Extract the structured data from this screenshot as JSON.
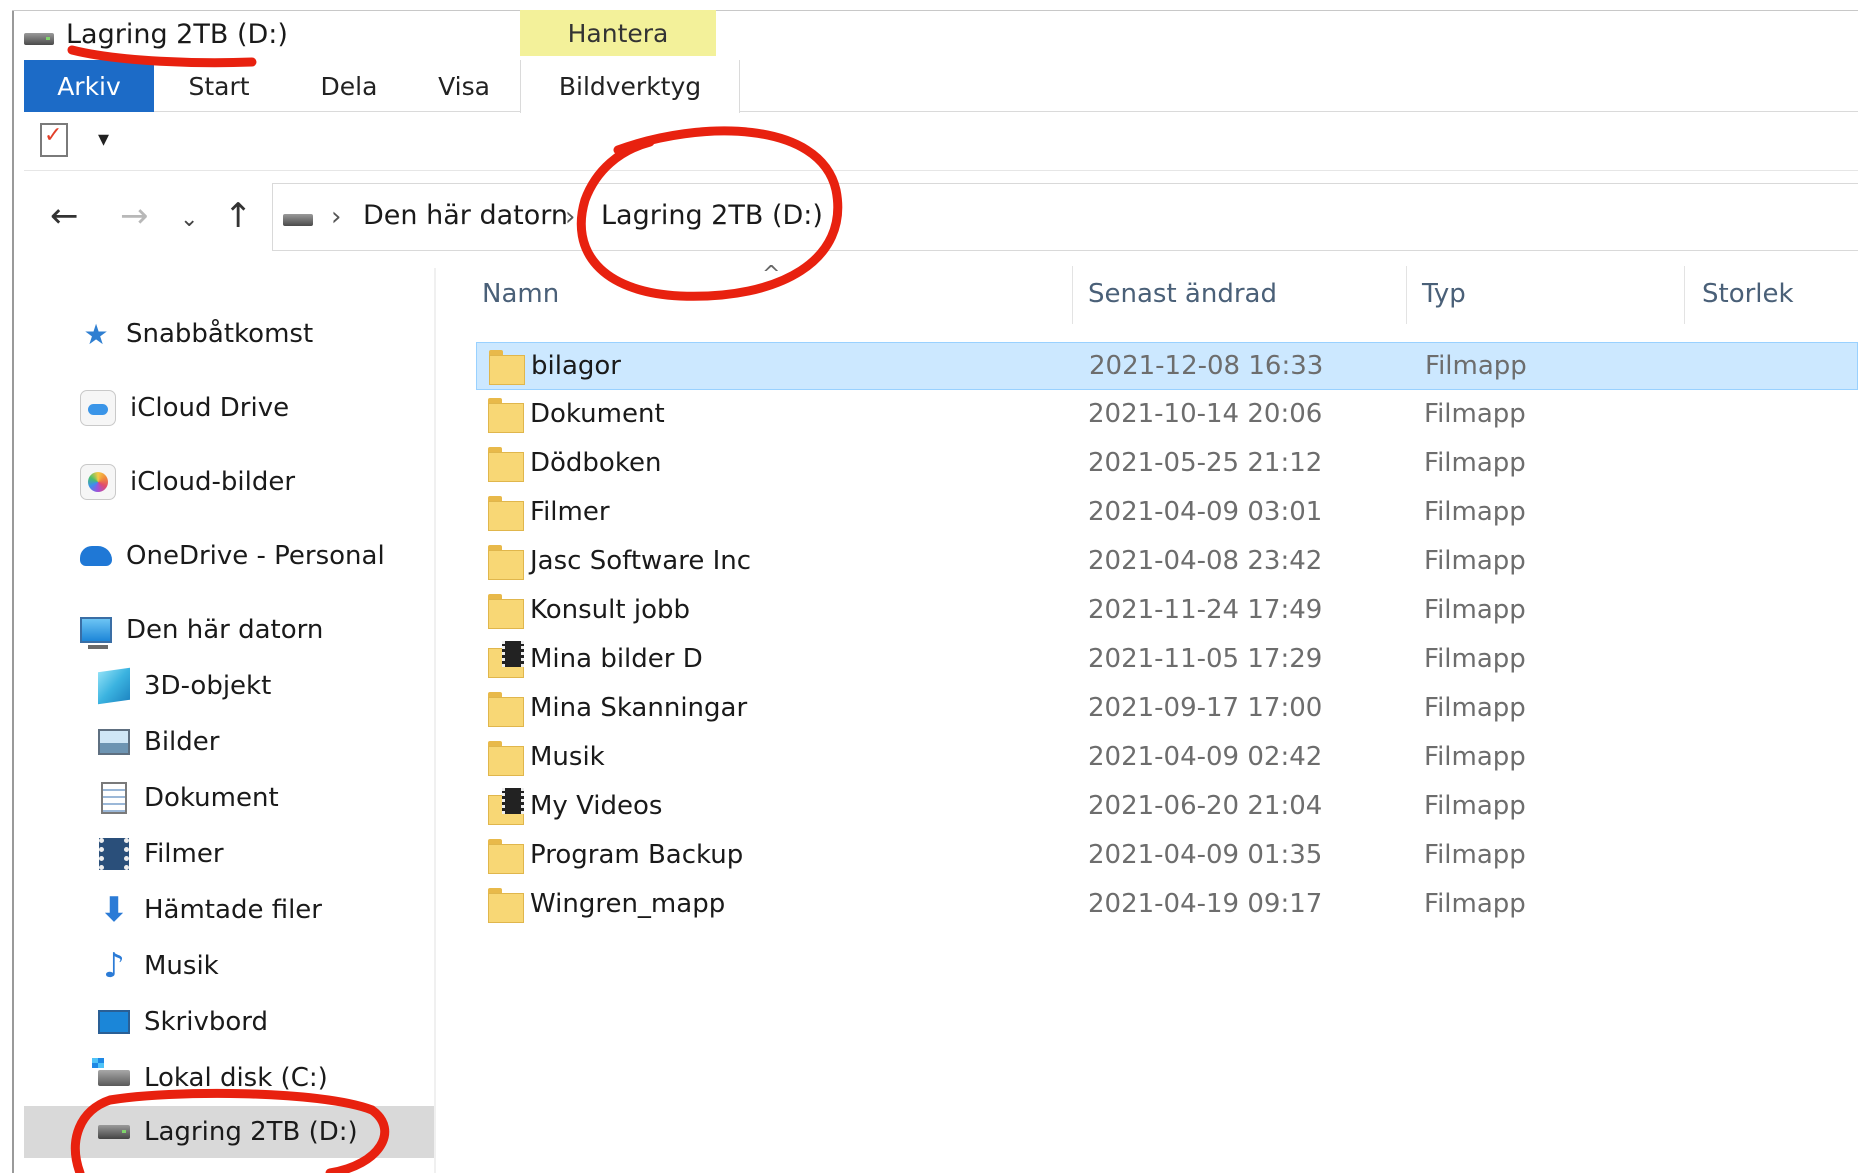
{
  "window": {
    "title": "Lagring 2TB (D:)"
  },
  "ribbon": {
    "context_group": "Hantera",
    "tabs": [
      {
        "label": "Arkiv"
      },
      {
        "label": "Start"
      },
      {
        "label": "Dela"
      },
      {
        "label": "Visa"
      },
      {
        "label": "Bildverktyg"
      }
    ]
  },
  "quick_access": {
    "customize_glyph": "▾"
  },
  "navigation": {
    "back_glyph": "←",
    "forward_glyph": "→",
    "recent_glyph": "⌄",
    "up_glyph": "↑",
    "breadcrumb": [
      "Den här datorn",
      "Lagring 2TB (D:)"
    ],
    "separator": "›"
  },
  "sidebar": {
    "items": [
      {
        "label": "Snabbåtkomst",
        "icon": "star-icon"
      },
      {
        "label": "iCloud Drive",
        "icon": "icloud-drive-icon"
      },
      {
        "label": "iCloud-bilder",
        "icon": "icloud-photos-icon"
      },
      {
        "label": "OneDrive - Personal",
        "icon": "onedrive-icon"
      },
      {
        "label": "Den här datorn",
        "icon": "computer-icon"
      },
      {
        "label": "3D-objekt",
        "icon": "cube-icon"
      },
      {
        "label": "Bilder",
        "icon": "pictures-icon"
      },
      {
        "label": "Dokument",
        "icon": "document-icon"
      },
      {
        "label": "Filmer",
        "icon": "film-icon"
      },
      {
        "label": "Hämtade filer",
        "icon": "download-icon"
      },
      {
        "label": "Musik",
        "icon": "music-icon"
      },
      {
        "label": "Skrivbord",
        "icon": "desktop-icon"
      },
      {
        "label": "Lokal disk (C:)",
        "icon": "local-disk-icon"
      },
      {
        "label": "Lagring 2TB (D:)",
        "icon": "drive-icon",
        "selected": true
      }
    ]
  },
  "file_list": {
    "sort_glyph": "^",
    "columns": [
      "Namn",
      "Senast ändrad",
      "Typ",
      "Storlek"
    ],
    "rows": [
      {
        "name": "bilagor",
        "modified": "2021-12-08 16:33",
        "type": "Filmapp",
        "icon": "folder-icon",
        "selected": true
      },
      {
        "name": "Dokument",
        "modified": "2021-10-14 20:06",
        "type": "Filmapp",
        "icon": "folder-icon"
      },
      {
        "name": "Dödboken",
        "modified": "2021-05-25 21:12",
        "type": "Filmapp",
        "icon": "folder-icon"
      },
      {
        "name": "Filmer",
        "modified": "2021-04-09 03:01",
        "type": "Filmapp",
        "icon": "folder-icon"
      },
      {
        "name": "Jasc Software Inc",
        "modified": "2021-04-08 23:42",
        "type": "Filmapp",
        "icon": "folder-icon"
      },
      {
        "name": "Konsult jobb",
        "modified": "2021-11-24 17:49",
        "type": "Filmapp",
        "icon": "folder-icon"
      },
      {
        "name": "Mina bilder D",
        "modified": "2021-11-05 17:29",
        "type": "Filmapp",
        "icon": "media-folder-icon"
      },
      {
        "name": "Mina Skanningar",
        "modified": "2021-09-17 17:00",
        "type": "Filmapp",
        "icon": "folder-icon"
      },
      {
        "name": "Musik",
        "modified": "2021-04-09 02:42",
        "type": "Filmapp",
        "icon": "folder-icon"
      },
      {
        "name": "My Videos",
        "modified": "2021-06-20 21:04",
        "type": "Filmapp",
        "icon": "media-folder-icon"
      },
      {
        "name": "Program Backup",
        "modified": "2021-04-09 01:35",
        "type": "Filmapp",
        "icon": "folder-icon"
      },
      {
        "name": "Wingren_mapp",
        "modified": "2021-04-19 09:17",
        "type": "Filmapp",
        "icon": "folder-icon"
      }
    ]
  },
  "colors": {
    "file_tab": "#1c6bc7",
    "context_tab": "#f3f19a",
    "selection": "#cce8ff",
    "annotation_red": "#e8210f"
  }
}
